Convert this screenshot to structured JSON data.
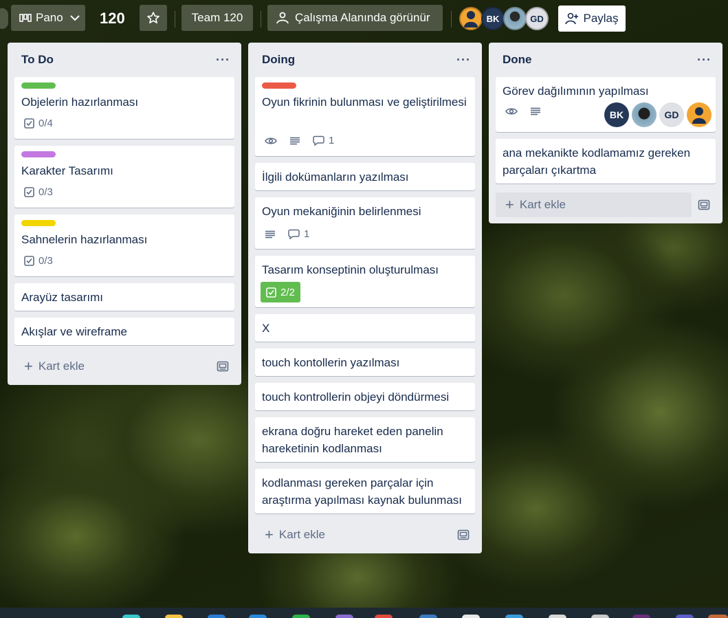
{
  "topbar": {
    "view_label": "Pano",
    "board_title": "120",
    "team_label": "Team 120",
    "visibility_label": "Çalışma Alanında görünür",
    "share_label": "Paylaş",
    "avatars": [
      {
        "initials": "",
        "kind": "person-icon",
        "color": "#f2a531"
      },
      {
        "initials": "BK",
        "color": "#253858"
      },
      {
        "initials": "",
        "kind": "photo",
        "color": "#7fa3b8"
      },
      {
        "initials": "GD",
        "color": "#dfe1e6"
      }
    ]
  },
  "lists": [
    {
      "title": "To Do",
      "menu": "···",
      "add_label": "Kart ekle",
      "cards": [
        {
          "title": "Objelerin hazırlanması",
          "label_color": "#61bd4f",
          "checklist": "0/4"
        },
        {
          "title": "Karakter Tasarımı",
          "label_color": "#c377e0",
          "checklist": "0/3"
        },
        {
          "title": "Sahnelerin hazırlanması",
          "label_color": "#f2d600",
          "checklist": "0/3"
        },
        {
          "title": "Arayüz tasarımı"
        },
        {
          "title": "Akışlar ve wireframe"
        }
      ]
    },
    {
      "title": "Doing",
      "menu": "···",
      "add_label": "Kart ekle",
      "cards": [
        {
          "title": "Oyun fikrinin bulunması ve geliştirilmesi",
          "label_color": "#eb5a46",
          "comments": "1"
        },
        {
          "title": "İlgili dokümanların yazılması"
        },
        {
          "title": "Oyun mekaniğinin belirlenmesi",
          "comments": "1"
        },
        {
          "title": "Tasarım konseptinin oluşturulması",
          "checklist": "2/2"
        },
        {
          "title": "X"
        },
        {
          "title": "touch kontollerin yazılması"
        },
        {
          "title": "touch kontrollerin objeyi döndürmesi"
        },
        {
          "title": "ekrana doğru hareket eden panelin hareketinin kodlanması"
        },
        {
          "title": "kodlanması gereken parçalar için araştırma yapılması kaynak bulunması"
        }
      ]
    },
    {
      "title": "Done",
      "menu": "···",
      "add_label": "Kart ekle",
      "cards": [
        {
          "title": "Görev dağılımının yapılması",
          "members": [
            "BK",
            "",
            "GD",
            ""
          ]
        },
        {
          "title": "ana mekanikte kodlamamız gereken parçaları çıkartma"
        }
      ]
    }
  ],
  "colors": {
    "list_bg": "#ebecf0",
    "card_text": "#172b4d",
    "muted_text": "#5e6c84",
    "checklist_complete": "#61bd4f"
  }
}
